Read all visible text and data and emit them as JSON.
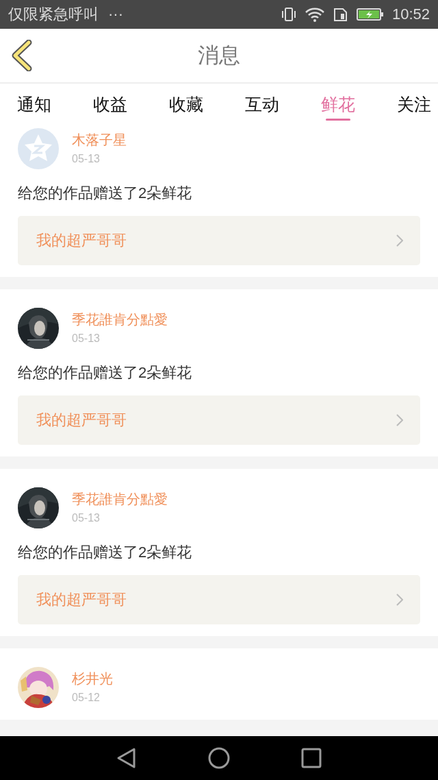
{
  "status_bar": {
    "notification": "仅限紧急呼叫",
    "more": "···",
    "time": "10:52"
  },
  "header": {
    "title": "消息"
  },
  "tabs": [
    {
      "label": "通知",
      "selected": false
    },
    {
      "label": "收益",
      "selected": false
    },
    {
      "label": "收藏",
      "selected": false
    },
    {
      "label": "互动",
      "selected": false
    },
    {
      "label": "鲜花",
      "selected": true
    },
    {
      "label": "关注",
      "selected": false
    }
  ],
  "messages": [
    {
      "avatar": {
        "kind": "default"
      },
      "name": "木落子星",
      "date": "05-13",
      "text": "给您的作品赠送了2朵鲜花",
      "work": "我的超严哥哥"
    },
    {
      "name": "季花誰肯分點愛",
      "date": "05-13",
      "text": "给您的作品赠送了2朵鲜花",
      "work": "我的超严哥哥"
    },
    {
      "name": "季花誰肯分點愛",
      "date": "05-13",
      "text": "给您的作品赠送了2朵鲜花",
      "work": "我的超严哥哥"
    },
    {
      "name": "杉井光",
      "date": "05-12"
    }
  ]
}
